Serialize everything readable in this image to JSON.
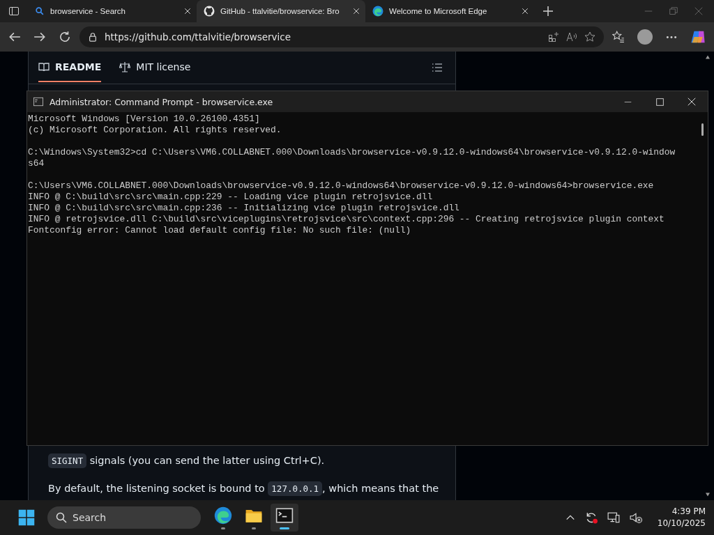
{
  "browser": {
    "tabs": [
      {
        "title": "browservice - Search",
        "selected": false
      },
      {
        "title": "GitHub - ttalvitie/browservice: Bro",
        "selected": true
      },
      {
        "title": "Welcome to Microsoft Edge",
        "selected": false
      }
    ],
    "url": "https://github.com/ttalvitie/browservice"
  },
  "readme": {
    "tabs": [
      {
        "label": "README",
        "selected": true
      },
      {
        "label": "MIT license",
        "selected": false
      }
    ],
    "paragraphs": [
      [
        {
          "kind": "code",
          "text": "SIGINT"
        },
        {
          "kind": "text",
          "text": " signals (you can send the latter using Ctrl+C)."
        }
      ],
      [
        {
          "kind": "text",
          "text": "By default, the listening socket is bound to "
        },
        {
          "kind": "code",
          "text": "127.0.0.1"
        },
        {
          "kind": "text",
          "text": ", which means that the"
        }
      ]
    ]
  },
  "terminal": {
    "title": "Administrator: Command Prompt - browservice.exe",
    "blocks": [
      [
        "Microsoft Windows [Version 10.0.26100.4351]",
        "(c) Microsoft Corporation. All rights reserved."
      ],
      [
        "C:\\Windows\\System32>cd C:\\Users\\VM6.COLLABNET.000\\Downloads\\browservice-v0.9.12.0-windows64\\browservice-v0.9.12.0-window",
        "s64"
      ],
      [
        "C:\\Users\\VM6.COLLABNET.000\\Downloads\\browservice-v0.9.12.0-windows64\\browservice-v0.9.12.0-windows64>browservice.exe",
        "INFO @ C:\\build\\src\\src\\main.cpp:229 -- Loading vice plugin retrojsvice.dll",
        "INFO @ C:\\build\\src\\src\\main.cpp:236 -- Initializing vice plugin retrojsvice.dll",
        "INFO @ retrojsvice.dll C:\\build\\src\\viceplugins\\retrojsvice\\src\\context.cpp:296 -- Creating retrojsvice plugin context",
        "Fontconfig error: Cannot load default config file: No such file: (null)"
      ]
    ]
  },
  "taskbar": {
    "search": {
      "placeholder": "Search"
    },
    "apps": [
      {
        "kind": "edge",
        "active": false
      },
      {
        "kind": "folder",
        "active": false
      },
      {
        "kind": "terminal",
        "active": true
      }
    ],
    "time": "4:39 PM",
    "date": "10/10/2025"
  }
}
